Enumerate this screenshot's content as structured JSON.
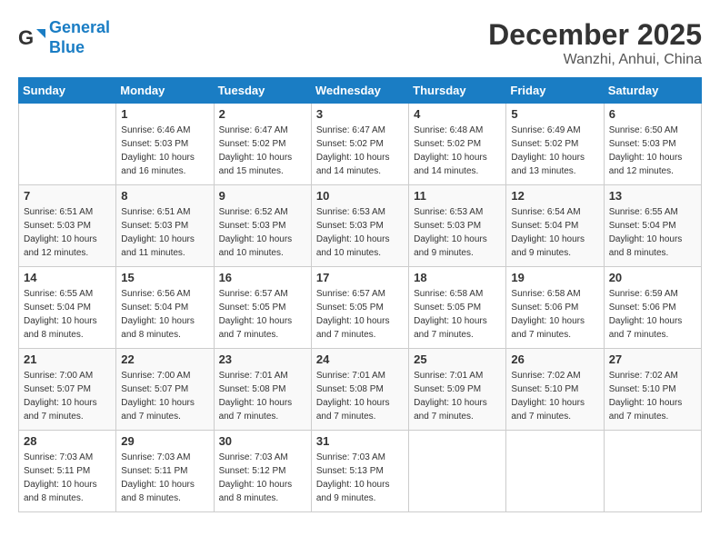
{
  "header": {
    "logo_line1": "General",
    "logo_line2": "Blue",
    "month": "December 2025",
    "location": "Wanzhi, Anhui, China"
  },
  "days_of_week": [
    "Sunday",
    "Monday",
    "Tuesday",
    "Wednesday",
    "Thursday",
    "Friday",
    "Saturday"
  ],
  "weeks": [
    [
      {
        "day": "",
        "info": ""
      },
      {
        "day": "1",
        "info": "Sunrise: 6:46 AM\nSunset: 5:03 PM\nDaylight: 10 hours\nand 16 minutes."
      },
      {
        "day": "2",
        "info": "Sunrise: 6:47 AM\nSunset: 5:02 PM\nDaylight: 10 hours\nand 15 minutes."
      },
      {
        "day": "3",
        "info": "Sunrise: 6:47 AM\nSunset: 5:02 PM\nDaylight: 10 hours\nand 14 minutes."
      },
      {
        "day": "4",
        "info": "Sunrise: 6:48 AM\nSunset: 5:02 PM\nDaylight: 10 hours\nand 14 minutes."
      },
      {
        "day": "5",
        "info": "Sunrise: 6:49 AM\nSunset: 5:02 PM\nDaylight: 10 hours\nand 13 minutes."
      },
      {
        "day": "6",
        "info": "Sunrise: 6:50 AM\nSunset: 5:03 PM\nDaylight: 10 hours\nand 12 minutes."
      }
    ],
    [
      {
        "day": "7",
        "info": "Sunrise: 6:51 AM\nSunset: 5:03 PM\nDaylight: 10 hours\nand 12 minutes."
      },
      {
        "day": "8",
        "info": "Sunrise: 6:51 AM\nSunset: 5:03 PM\nDaylight: 10 hours\nand 11 minutes."
      },
      {
        "day": "9",
        "info": "Sunrise: 6:52 AM\nSunset: 5:03 PM\nDaylight: 10 hours\nand 10 minutes."
      },
      {
        "day": "10",
        "info": "Sunrise: 6:53 AM\nSunset: 5:03 PM\nDaylight: 10 hours\nand 10 minutes."
      },
      {
        "day": "11",
        "info": "Sunrise: 6:53 AM\nSunset: 5:03 PM\nDaylight: 10 hours\nand 9 minutes."
      },
      {
        "day": "12",
        "info": "Sunrise: 6:54 AM\nSunset: 5:04 PM\nDaylight: 10 hours\nand 9 minutes."
      },
      {
        "day": "13",
        "info": "Sunrise: 6:55 AM\nSunset: 5:04 PM\nDaylight: 10 hours\nand 8 minutes."
      }
    ],
    [
      {
        "day": "14",
        "info": "Sunrise: 6:55 AM\nSunset: 5:04 PM\nDaylight: 10 hours\nand 8 minutes."
      },
      {
        "day": "15",
        "info": "Sunrise: 6:56 AM\nSunset: 5:04 PM\nDaylight: 10 hours\nand 8 minutes."
      },
      {
        "day": "16",
        "info": "Sunrise: 6:57 AM\nSunset: 5:05 PM\nDaylight: 10 hours\nand 7 minutes."
      },
      {
        "day": "17",
        "info": "Sunrise: 6:57 AM\nSunset: 5:05 PM\nDaylight: 10 hours\nand 7 minutes."
      },
      {
        "day": "18",
        "info": "Sunrise: 6:58 AM\nSunset: 5:05 PM\nDaylight: 10 hours\nand 7 minutes."
      },
      {
        "day": "19",
        "info": "Sunrise: 6:58 AM\nSunset: 5:06 PM\nDaylight: 10 hours\nand 7 minutes."
      },
      {
        "day": "20",
        "info": "Sunrise: 6:59 AM\nSunset: 5:06 PM\nDaylight: 10 hours\nand 7 minutes."
      }
    ],
    [
      {
        "day": "21",
        "info": "Sunrise: 7:00 AM\nSunset: 5:07 PM\nDaylight: 10 hours\nand 7 minutes."
      },
      {
        "day": "22",
        "info": "Sunrise: 7:00 AM\nSunset: 5:07 PM\nDaylight: 10 hours\nand 7 minutes."
      },
      {
        "day": "23",
        "info": "Sunrise: 7:01 AM\nSunset: 5:08 PM\nDaylight: 10 hours\nand 7 minutes."
      },
      {
        "day": "24",
        "info": "Sunrise: 7:01 AM\nSunset: 5:08 PM\nDaylight: 10 hours\nand 7 minutes."
      },
      {
        "day": "25",
        "info": "Sunrise: 7:01 AM\nSunset: 5:09 PM\nDaylight: 10 hours\nand 7 minutes."
      },
      {
        "day": "26",
        "info": "Sunrise: 7:02 AM\nSunset: 5:10 PM\nDaylight: 10 hours\nand 7 minutes."
      },
      {
        "day": "27",
        "info": "Sunrise: 7:02 AM\nSunset: 5:10 PM\nDaylight: 10 hours\nand 7 minutes."
      }
    ],
    [
      {
        "day": "28",
        "info": "Sunrise: 7:03 AM\nSunset: 5:11 PM\nDaylight: 10 hours\nand 8 minutes."
      },
      {
        "day": "29",
        "info": "Sunrise: 7:03 AM\nSunset: 5:11 PM\nDaylight: 10 hours\nand 8 minutes."
      },
      {
        "day": "30",
        "info": "Sunrise: 7:03 AM\nSunset: 5:12 PM\nDaylight: 10 hours\nand 8 minutes."
      },
      {
        "day": "31",
        "info": "Sunrise: 7:03 AM\nSunset: 5:13 PM\nDaylight: 10 hours\nand 9 minutes."
      },
      {
        "day": "",
        "info": ""
      },
      {
        "day": "",
        "info": ""
      },
      {
        "day": "",
        "info": ""
      }
    ]
  ]
}
